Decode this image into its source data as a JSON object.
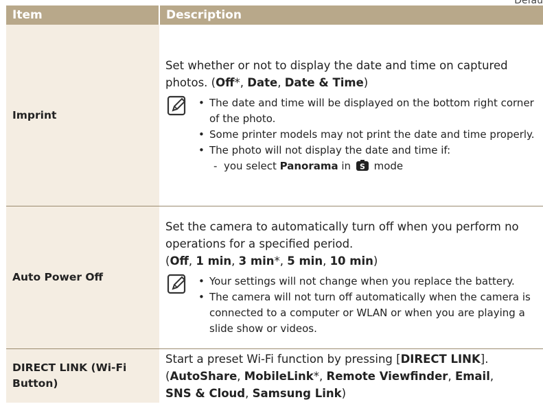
{
  "corner_text": "Defau",
  "header": {
    "item": "Item",
    "description": "Description"
  },
  "rows": [
    {
      "item": "Imprint",
      "desc_main": "Set whether or not to display the date and time on captured photos. (",
      "opts": [
        "Off",
        "*, ",
        "Date",
        ", ",
        "Date & Time",
        ")"
      ],
      "notes": [
        "The date and time will be displayed on the bottom right corner of the photo.",
        "Some printer models may not print the date and time properly.",
        "The photo will not display the date and time if:"
      ],
      "sub": {
        "dash": "-",
        "pre": "you select ",
        "bold": "Panorama",
        "mid": " in ",
        "icon": "S",
        "post": " mode"
      }
    },
    {
      "item": "Auto Power Off",
      "desc_main": "Set the camera to automatically turn off when you perform no operations for a specified period.",
      "opts": [
        "(",
        "Off",
        ", ",
        "1 min",
        ", ",
        "3 min",
        "*, ",
        "5 min",
        ", ",
        "10 min",
        ")"
      ],
      "notes": [
        "Your settings will not change when you replace the battery.",
        "The camera will not turn off automatically when the camera is connected to a computer or WLAN or when you are playing a slide show or videos."
      ]
    },
    {
      "item": "DIRECT LINK (Wi-Fi Button)",
      "desc_main": "Start a preset Wi-Fi function by pressing [",
      "key": "DIRECT LINK",
      "opts": [
        "].",
        "(",
        "AutoShare",
        ", ",
        "MobileLink",
        "*, ",
        "Remote Viewfinder",
        ", ",
        "Email",
        ", ",
        "SNS & Cloud",
        ", ",
        "Samsung Link",
        ")"
      ]
    }
  ],
  "bullet": "•",
  "icons": {
    "note": "note-pencil-icon",
    "mode": "smart-mode-icon"
  },
  "colors": {
    "header": "#b8a88a",
    "item_bg": "#f4ede2",
    "rule": "#9a8a6e"
  }
}
